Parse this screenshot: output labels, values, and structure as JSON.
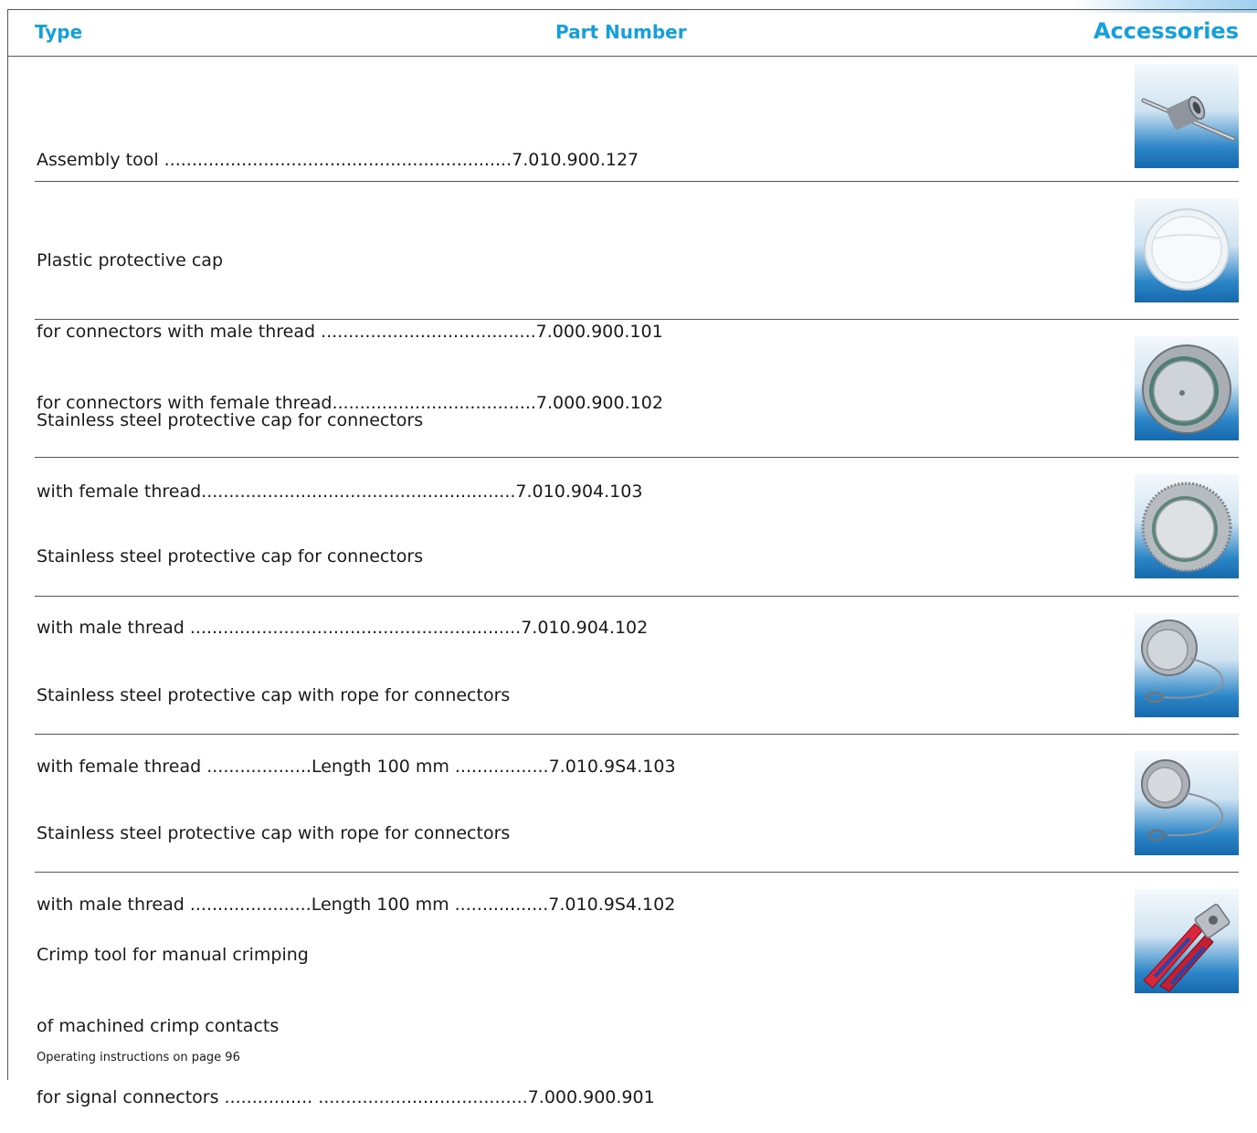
{
  "header": {
    "type_label": "Type",
    "part_label": "Part Number",
    "title": "Accessories"
  },
  "rows": [
    {
      "lines": [
        "Assembly tool ...............................................................7.010.900.127"
      ],
      "icon": "assembly-tool-icon"
    },
    {
      "lines": [
        "Plastic protective cap",
        "for connectors with male thread .......................................7.000.900.101",
        "for connectors with female thread.....................................7.000.900.102"
      ],
      "icon": "plastic-cap-icon"
    },
    {
      "lines": [
        "Stainless steel protective cap for connectors",
        "with female thread.........................................................7.010.904.103"
      ],
      "icon": "steel-cap-female-icon"
    },
    {
      "lines": [
        "Stainless steel protective cap for connectors",
        "with male thread ............................................................7.010.904.102"
      ],
      "icon": "steel-cap-male-icon"
    },
    {
      "lines": [
        "Stainless steel protective cap with rope for connectors",
        "with female thread ...................Length 100 mm .................7.010.9S4.103"
      ],
      "icon": "steel-cap-rope-female-icon"
    },
    {
      "lines": [
        "Stainless steel protective cap with rope for connectors",
        "with male thread ......................Length 100 mm .................7.010.9S4.102"
      ],
      "icon": "steel-cap-rope-male-icon"
    },
    {
      "lines": [
        "Crimp tool for manual crimping",
        "of machined crimp contacts",
        "for signal connectors ................ ......................................7.000.900.901"
      ],
      "icon": "crimp-tool-icon"
    }
  ],
  "footer": "Operating instructions on page 96"
}
